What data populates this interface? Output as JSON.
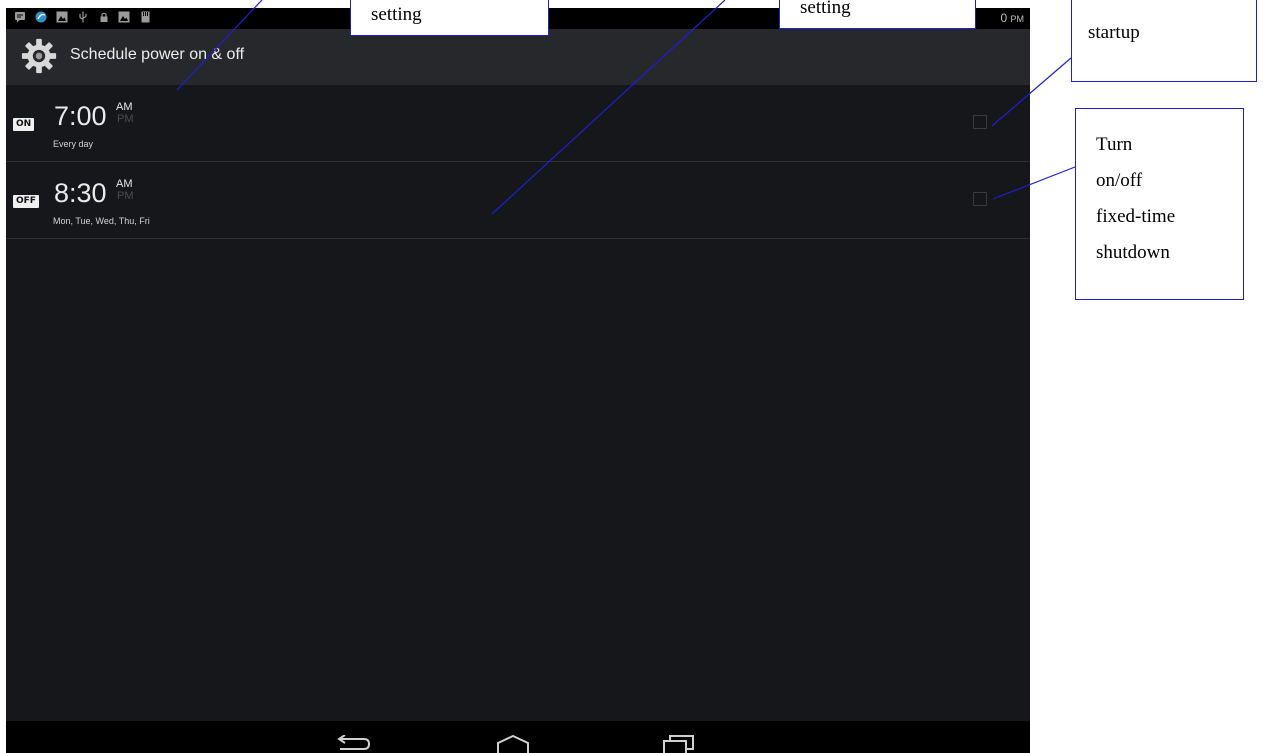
{
  "status_bar": {
    "icons": [
      "chat-icon",
      "app-icon",
      "image-icon",
      "usb-icon",
      "lock-icon",
      "image-icon",
      "sd-card-icon"
    ],
    "clock_visible": "0",
    "clock_ampm": "PM"
  },
  "action_bar": {
    "title": "Schedule power on & off",
    "icon": "gear-icon"
  },
  "schedules": [
    {
      "badge": "ON",
      "time": "7:00",
      "am": "AM",
      "pm": "PM",
      "selected_period": "AM",
      "repeat": "Every day",
      "checked": false
    },
    {
      "badge": "OFF",
      "time": "8:30",
      "am": "AM",
      "pm": "PM",
      "selected_period": "AM",
      "repeat": "Mon, Tue, Wed, Thu, Fri",
      "checked": false
    }
  ],
  "nav_bar": {
    "buttons": [
      "back-icon",
      "home-icon",
      "recent-apps-icon"
    ]
  },
  "callouts": {
    "startup_setting_visible": "setting",
    "shutdown_setting_visible": "setting",
    "startup_toggle_visible": "startup",
    "shutdown_toggle_lines": [
      "Turn",
      "on/off",
      "fixed-time",
      "shutdown"
    ]
  },
  "colors": {
    "screen_bg": "#16171b",
    "action_bar_bg": "#27282b",
    "callout_border": "#1f1fd2",
    "leader_line": "#1f1fd2"
  }
}
